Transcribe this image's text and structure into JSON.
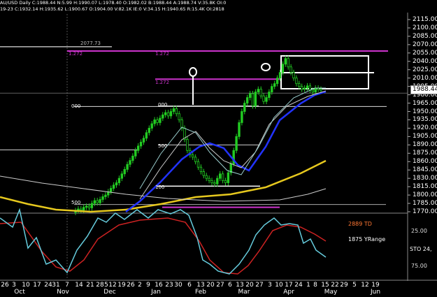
{
  "header": {
    "line1": "AU/USD Daily  C:1988.44  N:5.99  H:1990.07  L:1978.40  O:1982.02  B:1988.44  A:1988.74  V:35.8K  OI:0",
    "line2": "19-23  C:1932.14  H:1935.62  L:1900.67  O:1904.00  V:82.1K  IE:0  V:34.15  H:1940.65  R:15.4K  OI:2818"
  },
  "price_axis": {
    "labels": [
      "2115.00",
      "2100.00",
      "2085.00",
      "2070.00",
      "2055.00",
      "2040.00",
      "2025.00",
      "2010.00",
      "1995.00",
      "1980.00",
      "1965.00",
      "1950.00",
      "1935.00",
      "1920.00",
      "1905.00",
      "1890.00",
      "1875.00",
      "1860.00",
      "1845.00",
      "1830.00",
      "1815.00",
      "1800.00",
      "1785.00",
      "1770.00"
    ],
    "last_price": "1988.44"
  },
  "annotations": {
    "level_2077": "2077.73",
    "fib_1": "1.272",
    "fib_2": "1.272",
    "fib_3": "1.272",
    "fib_4": "000",
    "fib_5": "000",
    "fib_6": "500",
    "fib_7": "100",
    "fib_8": "500"
  },
  "indicator": {
    "label_td": "2889 TD",
    "label_yrange": "1875 YRange",
    "label_sto": "STO 24,",
    "axis_top": "25.00",
    "axis_bottom": "75.00",
    "colors": {
      "td": "#ff7733",
      "sto": "#ffffff"
    }
  },
  "x_axis": {
    "days": [
      "26",
      "3",
      "10",
      "17",
      "24",
      "31",
      "7",
      "14",
      "21",
      "28",
      "5",
      "12",
      "19",
      "26",
      "2",
      "9",
      "16",
      "23",
      "30",
      "6",
      "13",
      "20",
      "27",
      "6",
      "13",
      "20",
      "27",
      "3",
      "10",
      "17",
      "24",
      "1",
      "8",
      "15",
      "22",
      "29",
      "5",
      "12",
      "19"
    ],
    "months": [
      "Oct",
      "Nov",
      "Dec",
      "Jan",
      "Feb",
      "Mar",
      "Apr",
      "May",
      "Jun"
    ]
  },
  "colors": {
    "background": "#000000",
    "candle": "#22cc22",
    "ma_blue": "#2233ff",
    "ma_yellow": "#e6c81e",
    "fib_magenta": "#cc33cc",
    "sto_cyan": "#66ccdd",
    "td_red": "#cc2222"
  }
}
